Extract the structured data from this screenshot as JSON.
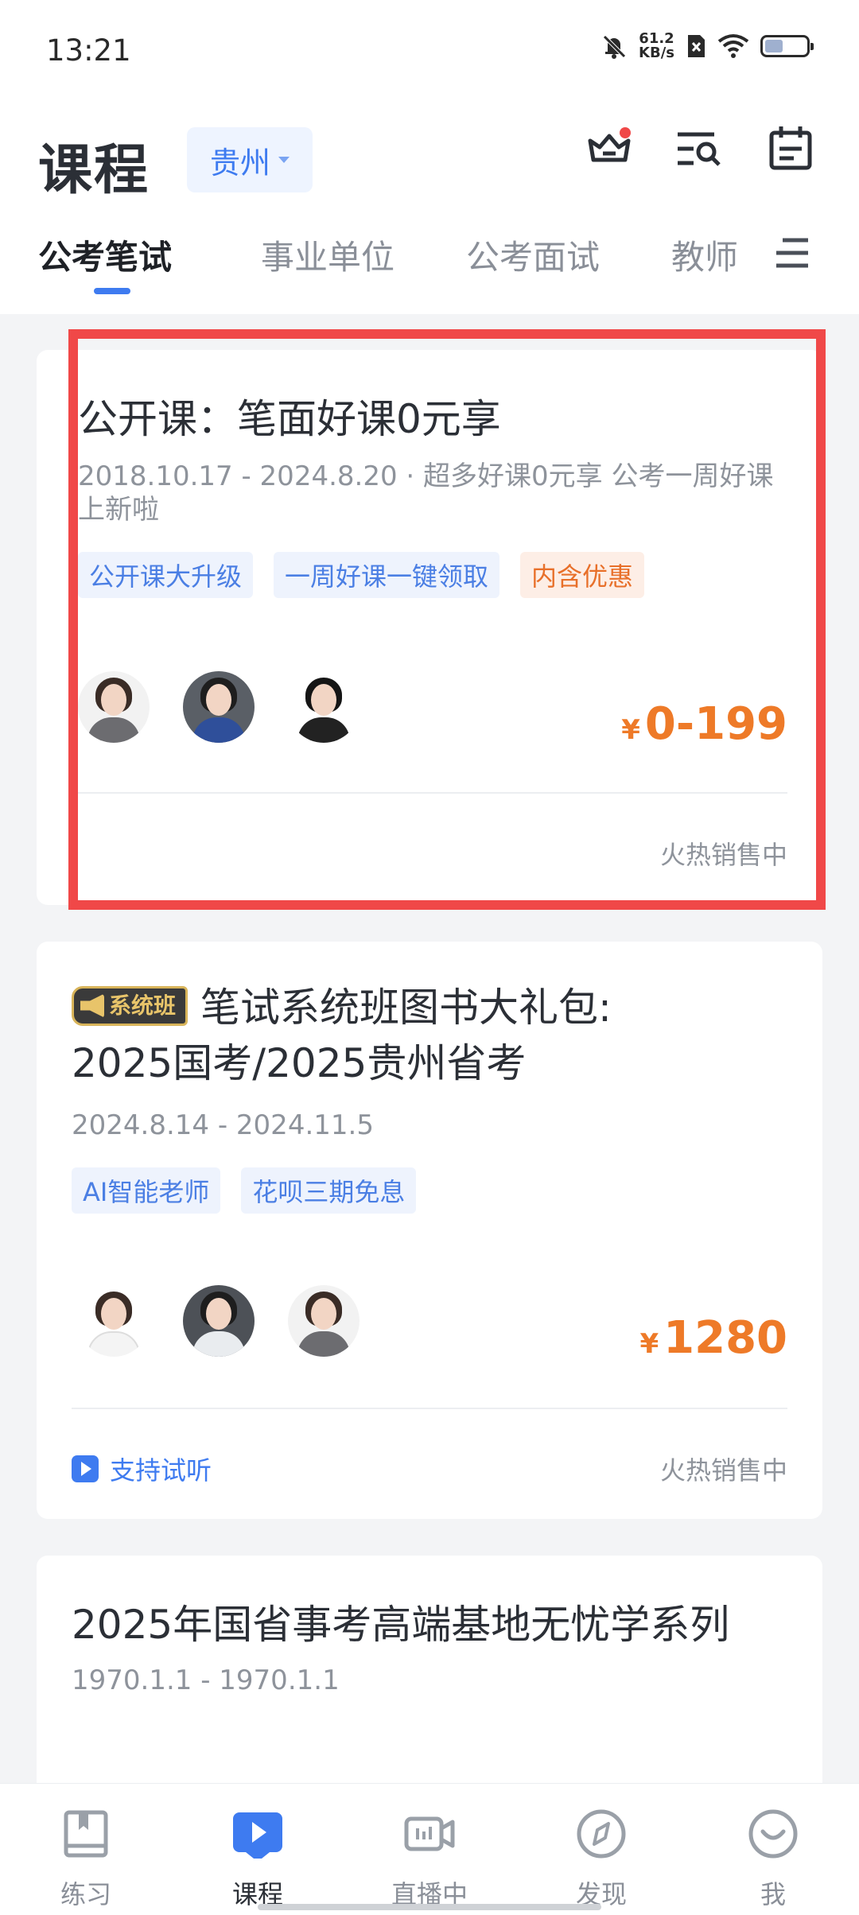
{
  "status": {
    "time": "13:21",
    "speed_value": "61.2",
    "speed_unit": "KB/s"
  },
  "header": {
    "title": "课程",
    "city": "贵州"
  },
  "tabs": [
    "公考笔试",
    "事业单位",
    "公考面试",
    "教师"
  ],
  "cards": [
    {
      "title": "公开课：笔面好课0元享",
      "date_line1": "2018.10.17 - 2024.8.20 · 超多好课0元享  公考一周好课",
      "date_line2": "上新啦",
      "tags": [
        "公开课大升级",
        "一周好课一键领取",
        "内含优惠"
      ],
      "price_symbol": "¥",
      "price": "0-199",
      "status": "火热销售中"
    },
    {
      "badge": "系统班",
      "title_line1": "笔试系统班图书大礼包:",
      "title_line2": "2025国考/2025贵州省考",
      "date": "2024.8.14 - 2024.11.5",
      "tags": [
        "AI智能老师",
        "花呗三期免息"
      ],
      "price_symbol": "¥",
      "price": "1280",
      "trial": "支持试听",
      "status": "火热销售中"
    },
    {
      "title": "2025年国省事考高端基地无忧学系列",
      "date": "1970.1.1 - 1970.1.1"
    }
  ],
  "bottom_nav": [
    "练习",
    "课程",
    "直播中",
    "发现",
    "我"
  ],
  "colors": {
    "accent": "#3e7bf0",
    "price": "#ee7a28",
    "highlight": "#f04848"
  }
}
